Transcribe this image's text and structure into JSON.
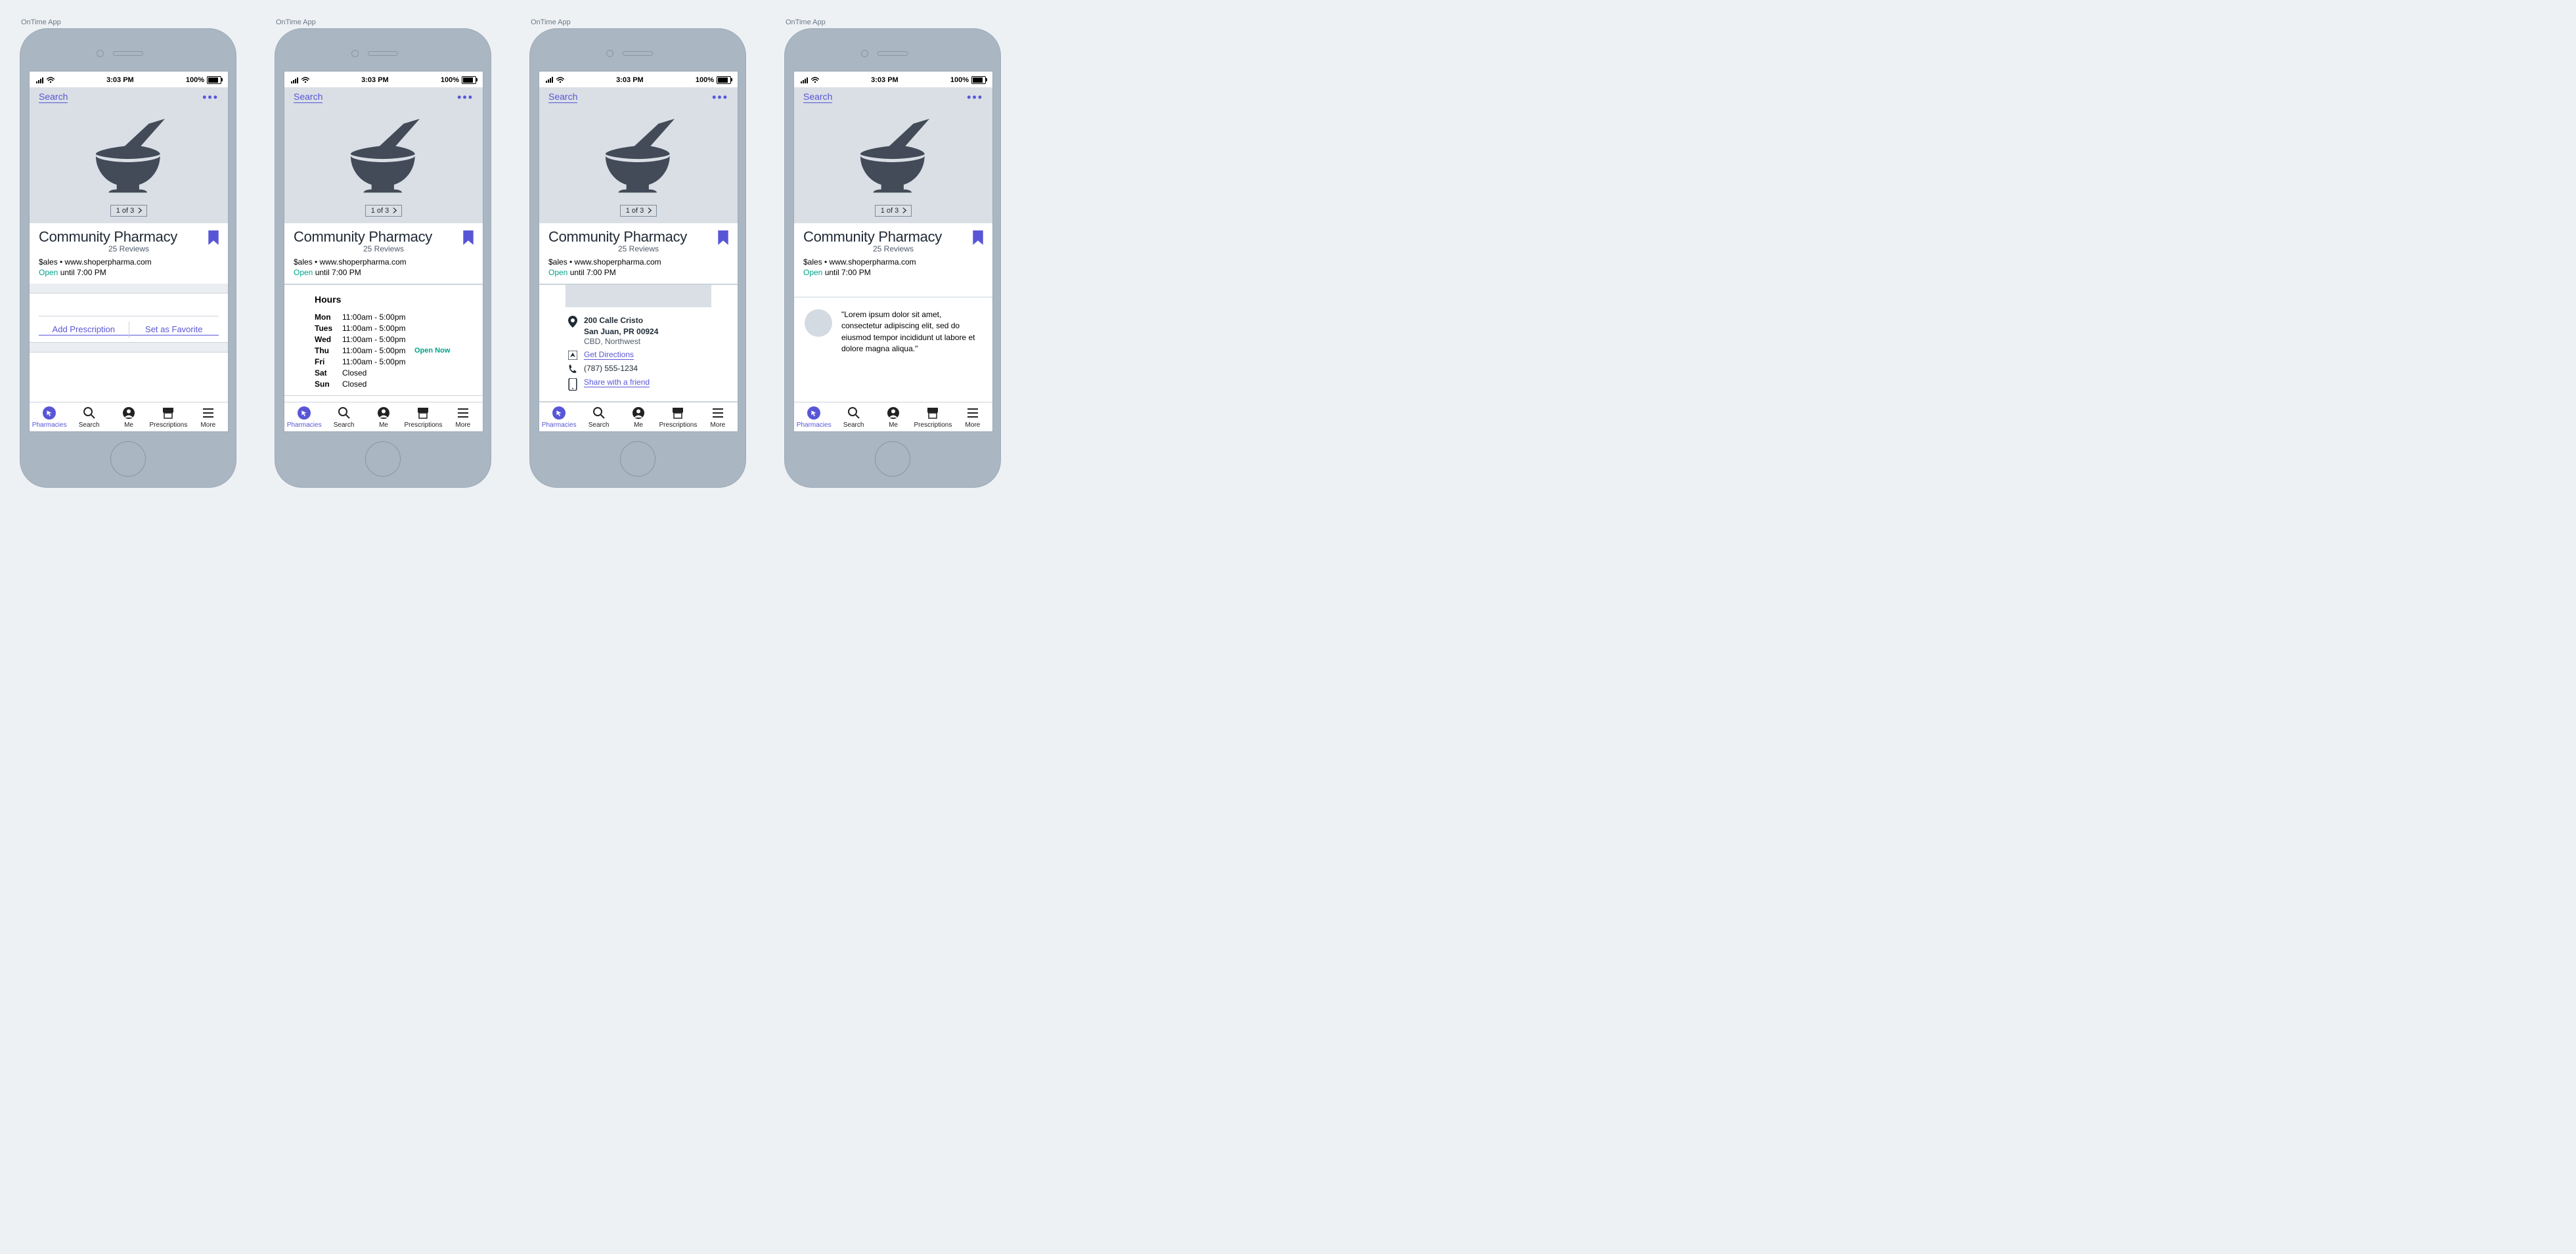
{
  "app_label": "OnTime App",
  "status": {
    "time": "3:03 PM",
    "battery": "100%"
  },
  "nav": {
    "back": "Search"
  },
  "pager": {
    "label": "1 of 3"
  },
  "pharmacy": {
    "name": "Community Pharmacy",
    "reviews": "25 Reviews",
    "meta": "$ales   • www.shoperpharma.com",
    "open_label": "Open",
    "open_until": "until 7:00 PM"
  },
  "actions": {
    "add_rx": "Add Prescription",
    "favorite": "Set as Favorite"
  },
  "hours": {
    "title": "Hours",
    "open_now": "Open Now",
    "rows": [
      {
        "day": "Mon",
        "time": "11:00am - 5:00pm"
      },
      {
        "day": "Tues",
        "time": "11:00am - 5:00pm"
      },
      {
        "day": "Wed",
        "time": "11:00am - 5:00pm"
      },
      {
        "day": "Thu",
        "time": "11:00am - 5:00pm",
        "open_now": true
      },
      {
        "day": "Fri",
        "time": "11:00am - 5:00pm"
      },
      {
        "day": "Sat",
        "time": "Closed"
      },
      {
        "day": "Sun",
        "time": "Closed"
      }
    ]
  },
  "location": {
    "address1": "200 Calle Cristo",
    "address2": "San Juan, PR 00924",
    "neighborhood": "CBD, Northwest",
    "directions": "Get Directions",
    "phone": "(787) 555-1234",
    "share": "Share with a friend"
  },
  "review": {
    "text": "\"Lorem ipsum dolor sit amet, consectetur adipiscing elit, sed do eiusmod tempor incididunt ut labore et dolore magna aliqua.\""
  },
  "tabs": {
    "pharmacies": "Pharmacies",
    "search": "Search",
    "me": "Me",
    "prescriptions": "Prescriptions",
    "more": "More"
  }
}
